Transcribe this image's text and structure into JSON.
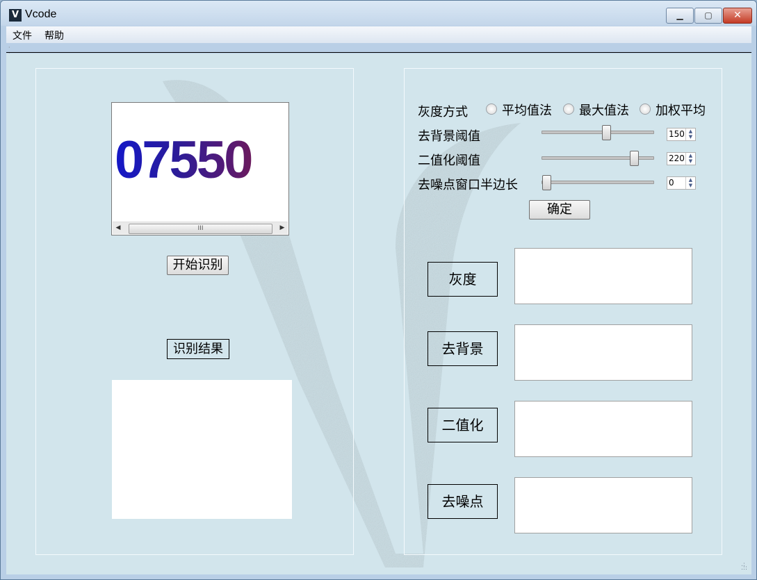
{
  "window": {
    "title": "Vcode",
    "icon_letter": "V"
  },
  "title_buttons": {
    "min": "▁",
    "max": "▢",
    "close": "✕"
  },
  "menu": {
    "items": [
      "文件",
      "帮助"
    ]
  },
  "left": {
    "captcha_text": "07550",
    "scroll_thumb_grip": "III",
    "start_button": "开始识别",
    "result_label": "识别结果",
    "result_value": ""
  },
  "right": {
    "gray_mode_label": "灰度方式",
    "gray_mode_options": [
      "平均值法",
      "最大值法",
      "加权平均"
    ],
    "bg_threshold_label": "去背景阈值",
    "bg_threshold_value": "150",
    "bin_threshold_label": "二值化阈值",
    "bin_threshold_value": "220",
    "denoise_label": "去噪点窗口半边长",
    "denoise_value": "0",
    "confirm_button": "确定",
    "stages": [
      "灰度",
      "去背景",
      "二值化",
      "去噪点"
    ]
  },
  "slider_levels": {
    "bg_threshold": 0.59,
    "bin_threshold": 0.86,
    "denoise": 0.0
  },
  "colors": {
    "client_bg": "#d2e5ec",
    "titlebar": "#c3d6ea",
    "close_button": "#c43b25"
  }
}
